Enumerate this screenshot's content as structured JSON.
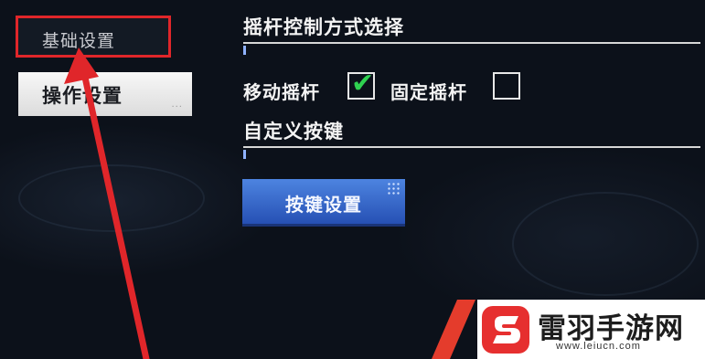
{
  "nav": {
    "basic_settings": "基础设置",
    "operation_settings": "操作设置"
  },
  "joystick": {
    "heading": "摇杆控制方式选择",
    "move_label": "移动摇杆",
    "move_checked": true,
    "fixed_label": "固定摇杆",
    "fixed_checked": false
  },
  "custom_keys": {
    "heading": "自定义按键",
    "button_label": "按键设置"
  },
  "colors": {
    "highlight": "#e0262a",
    "check": "#2fd150",
    "button": "#3466c8"
  },
  "watermark": {
    "name": "雷羽手游网",
    "url": "www.leiucn.com"
  }
}
